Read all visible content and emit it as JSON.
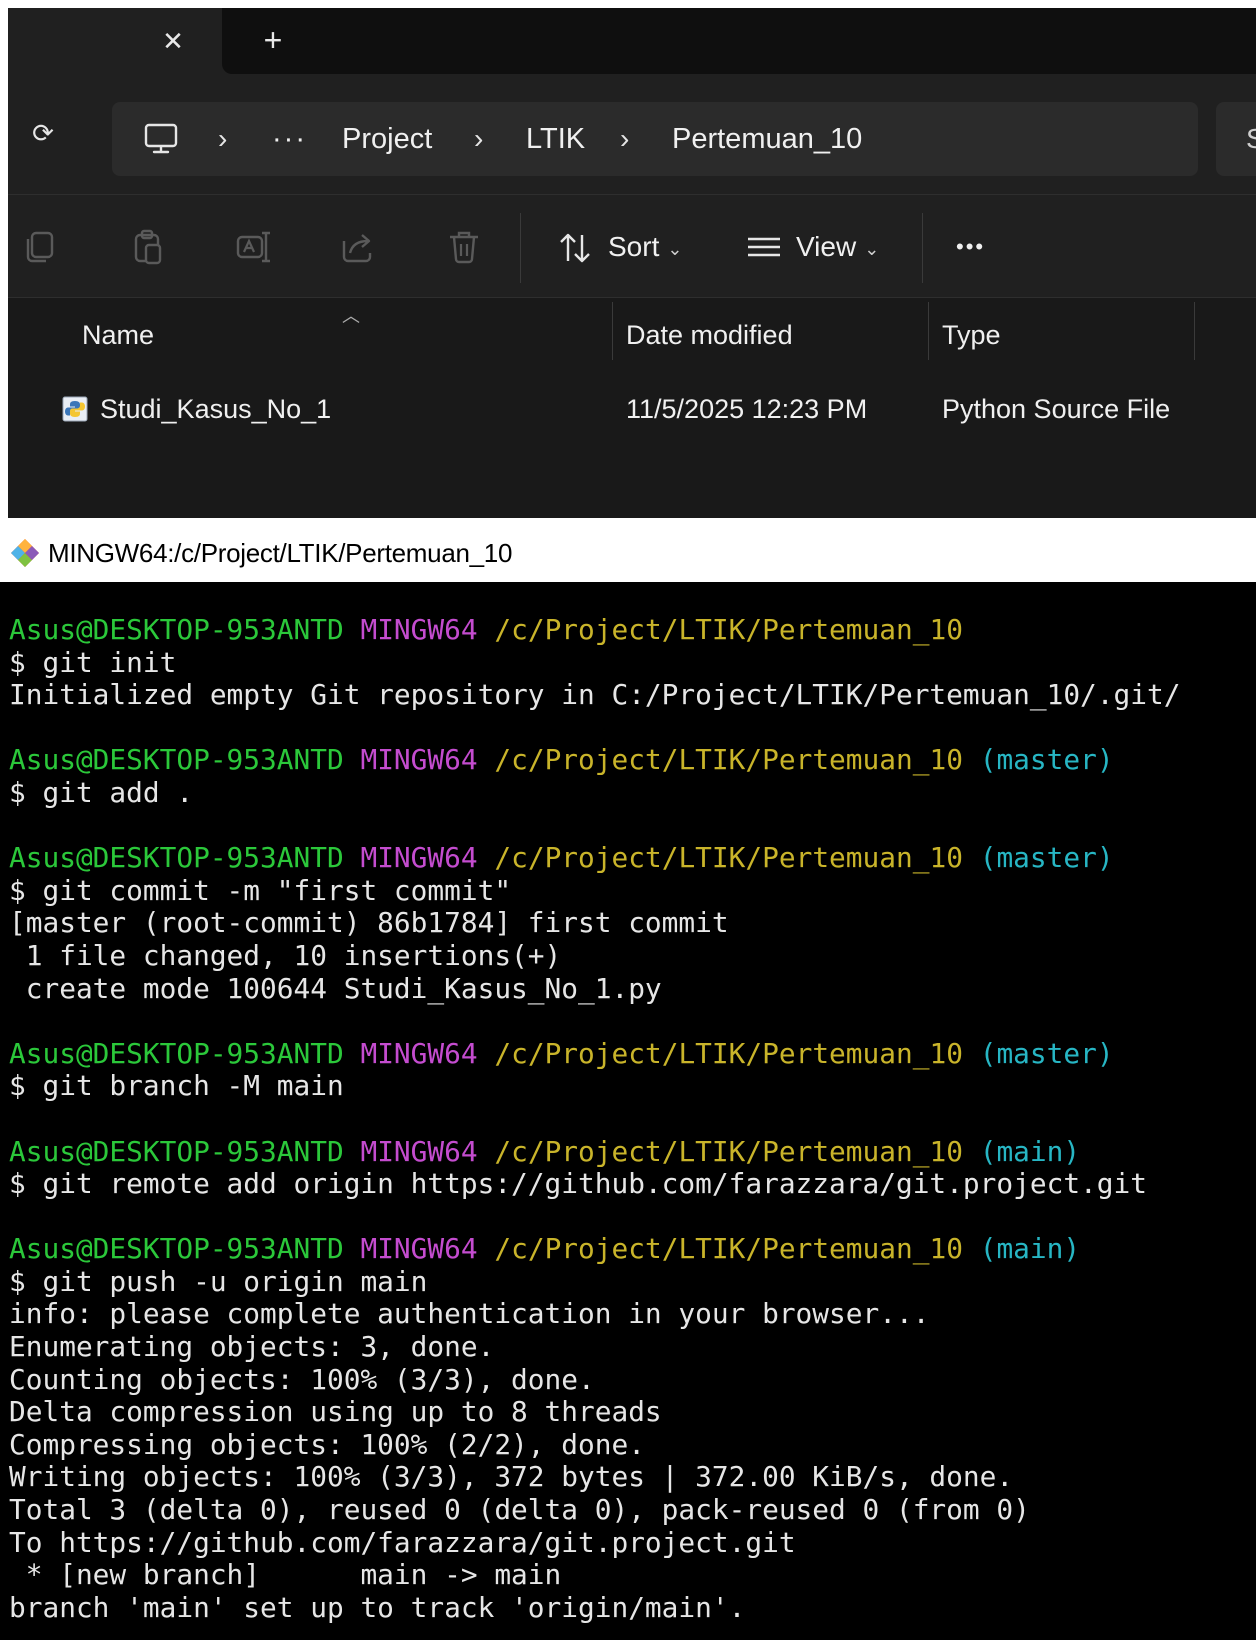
{
  "explorer": {
    "tab": {
      "close_glyph": "✕",
      "new_glyph": "+"
    },
    "address": {
      "refresh_glyph": "⟳",
      "ellipsis": "···",
      "crumbs": [
        "Project",
        "LTIK",
        "Pertemuan_10"
      ],
      "search_partial": "S"
    },
    "toolbar": {
      "sort_label": "Sort",
      "view_label": "View",
      "more_glyph": "•••"
    },
    "columns": {
      "name": "Name",
      "date": "Date modified",
      "type": "Type"
    },
    "files": [
      {
        "name": "Studi_Kasus_No_1",
        "date": "11/5/2025 12:23 PM",
        "type": "Python Source File"
      }
    ]
  },
  "terminal": {
    "title": "MINGW64:/c/Project/LTIK/Pertemuan_10",
    "colors": {
      "user": "#2bc83a",
      "shell": "#c44ccf",
      "path": "#c9b42a",
      "branch": "#27b6c4"
    },
    "prompt": {
      "user": "Asus@DESKTOP-953ANTD",
      "shell": "MINGW64",
      "path": "/c/Project/LTIK/Pertemuan_10"
    },
    "blocks": [
      {
        "branch": "",
        "command": "$ git init",
        "output": [
          "Initialized empty Git repository in C:/Project/LTIK/Pertemuan_10/.git/"
        ]
      },
      {
        "branch": "(master)",
        "command": "$ git add .",
        "output": []
      },
      {
        "branch": "(master)",
        "command": "$ git commit -m \"first commit\"",
        "output": [
          "[master (root-commit) 86b1784] first commit",
          " 1 file changed, 10 insertions(+)",
          " create mode 100644 Studi_Kasus_No_1.py"
        ]
      },
      {
        "branch": "(master)",
        "command": "$ git branch -M main",
        "output": []
      },
      {
        "branch": "(main)",
        "command": "$ git remote add origin https://github.com/farazzara/git.project.git",
        "output": []
      },
      {
        "branch": "(main)",
        "command": "$ git push -u origin main",
        "output": [
          "info: please complete authentication in your browser...",
          "Enumerating objects: 3, done.",
          "Counting objects: 100% (3/3), done.",
          "Delta compression using up to 8 threads",
          "Compressing objects: 100% (2/2), done.",
          "Writing objects: 100% (3/3), 372 bytes | 372.00 KiB/s, done.",
          "Total 3 (delta 0), reused 0 (delta 0), pack-reused 0 (from 0)",
          "To https://github.com/farazzara/git.project.git",
          " * [new branch]      main -> main",
          "branch 'main' set up to track 'origin/main'."
        ]
      }
    ]
  }
}
